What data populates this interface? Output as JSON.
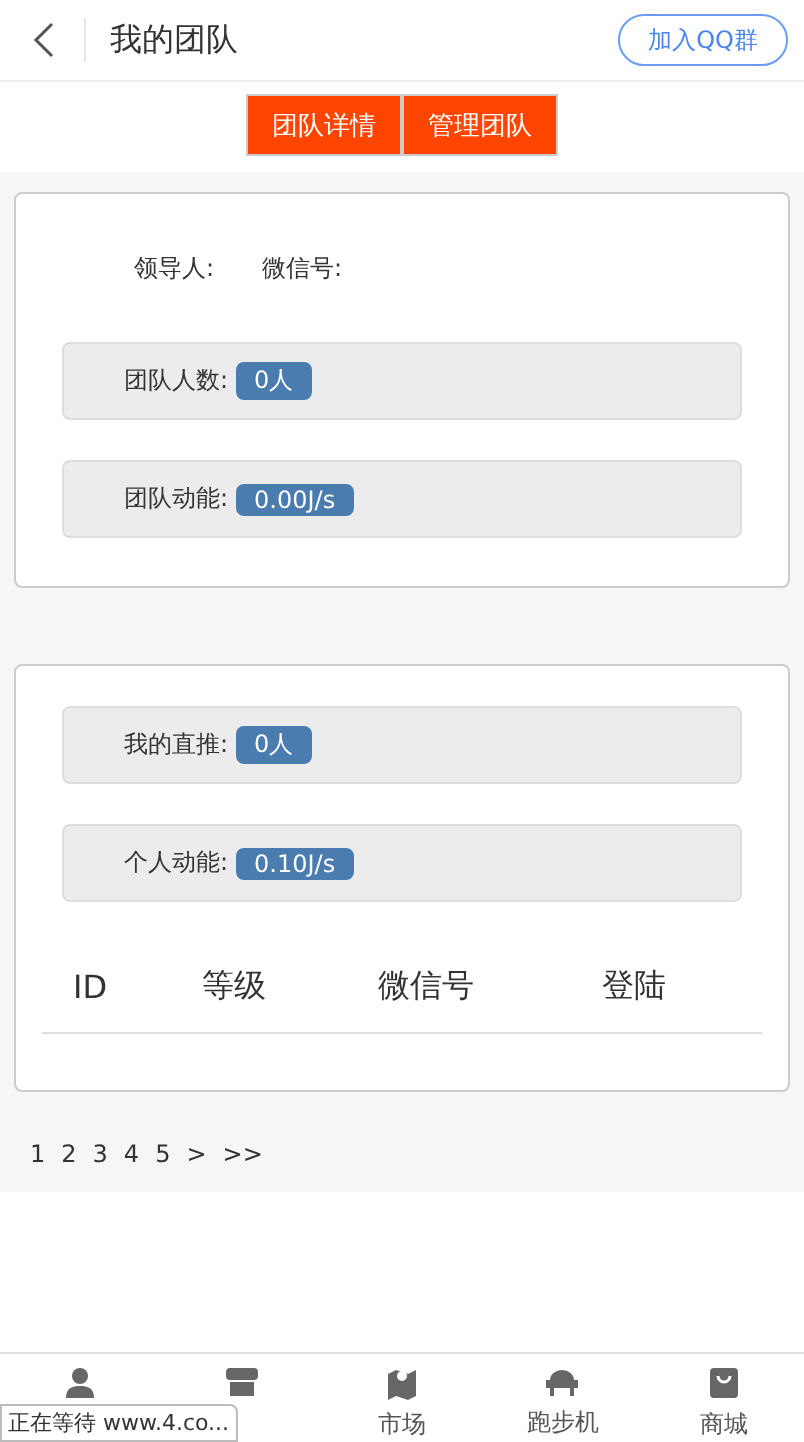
{
  "header": {
    "title": "我的团队",
    "action": "加入QQ群"
  },
  "tabs": [
    {
      "label": "团队详情"
    },
    {
      "label": "管理团队"
    }
  ],
  "team_card": {
    "leader_label": "领导人:",
    "wechat_label": "微信号:",
    "stats": [
      {
        "label": "团队人数:",
        "value": "0人"
      },
      {
        "label": "团队动能:",
        "value": "0.00J/s"
      }
    ]
  },
  "personal_card": {
    "stats": [
      {
        "label": "我的直推:",
        "value": "0人"
      },
      {
        "label": "个人动能:",
        "value": "0.10J/s"
      }
    ],
    "table": {
      "columns": [
        "ID",
        "等级",
        "微信号",
        "登陆"
      ]
    }
  },
  "pagination": [
    "1",
    "2",
    "3",
    "4",
    "5",
    ">",
    ">>"
  ],
  "bottom_nav": [
    {
      "kind": "person"
    },
    {
      "kind": "shop"
    },
    {
      "kind": "map",
      "label": "市场"
    },
    {
      "kind": "machine",
      "label": "跑步机"
    },
    {
      "kind": "bag",
      "label": "商城"
    }
  ],
  "status_bubble": "正在等待 www.4.co..."
}
